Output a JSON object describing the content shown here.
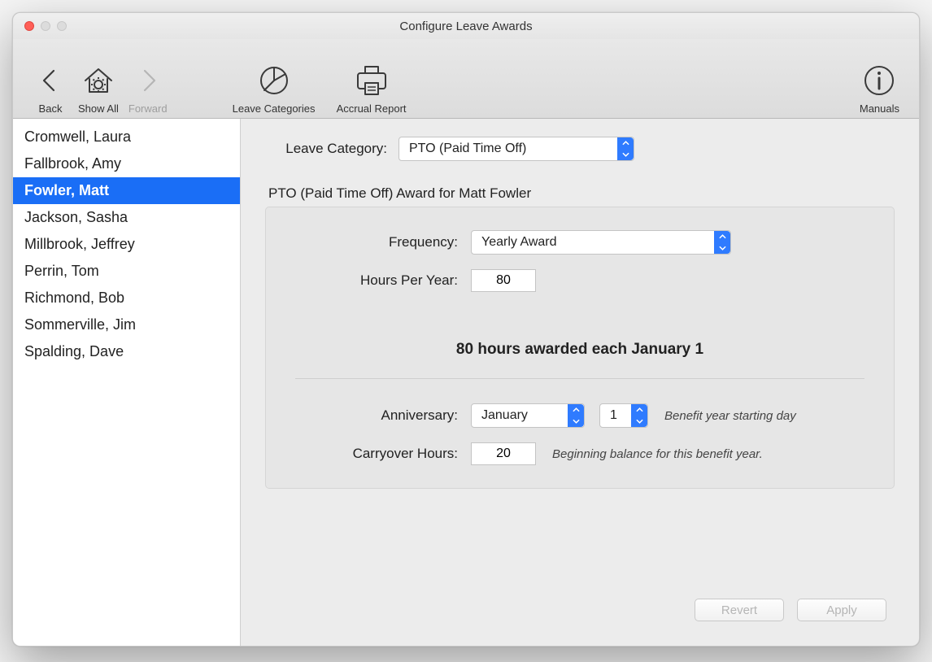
{
  "window": {
    "title": "Configure Leave Awards"
  },
  "toolbar": {
    "back": "Back",
    "show_all": "Show All",
    "forward": "Forward",
    "leave_categories": "Leave Categories",
    "accrual_report": "Accrual Report",
    "manuals": "Manuals"
  },
  "sidebar": {
    "items": [
      {
        "name": "Cromwell, Laura",
        "selected": false
      },
      {
        "name": "Fallbrook, Amy",
        "selected": false
      },
      {
        "name": "Fowler, Matt",
        "selected": true
      },
      {
        "name": "Jackson, Sasha",
        "selected": false
      },
      {
        "name": "Millbrook, Jeffrey",
        "selected": false
      },
      {
        "name": "Perrin, Tom",
        "selected": false
      },
      {
        "name": "Richmond, Bob",
        "selected": false
      },
      {
        "name": "Sommerville, Jim",
        "selected": false
      },
      {
        "name": "Spalding, Dave",
        "selected": false
      }
    ]
  },
  "form": {
    "leave_category_label": "Leave Category:",
    "leave_category_value": "PTO (Paid Time Off)",
    "panel_title": "PTO (Paid Time Off) Award for Matt Fowler",
    "frequency_label": "Frequency:",
    "frequency_value": "Yearly Award",
    "hours_per_year_label": "Hours Per Year:",
    "hours_per_year_value": "80",
    "summary_text": "80 hours awarded each January 1",
    "anniversary_label": "Anniversary:",
    "anniversary_month": "January",
    "anniversary_day": "1",
    "anniversary_hint": "Benefit year starting day",
    "carryover_label": "Carryover Hours:",
    "carryover_value": "20",
    "carryover_hint": "Beginning balance for this benefit year."
  },
  "footer": {
    "revert": "Revert",
    "apply": "Apply"
  }
}
